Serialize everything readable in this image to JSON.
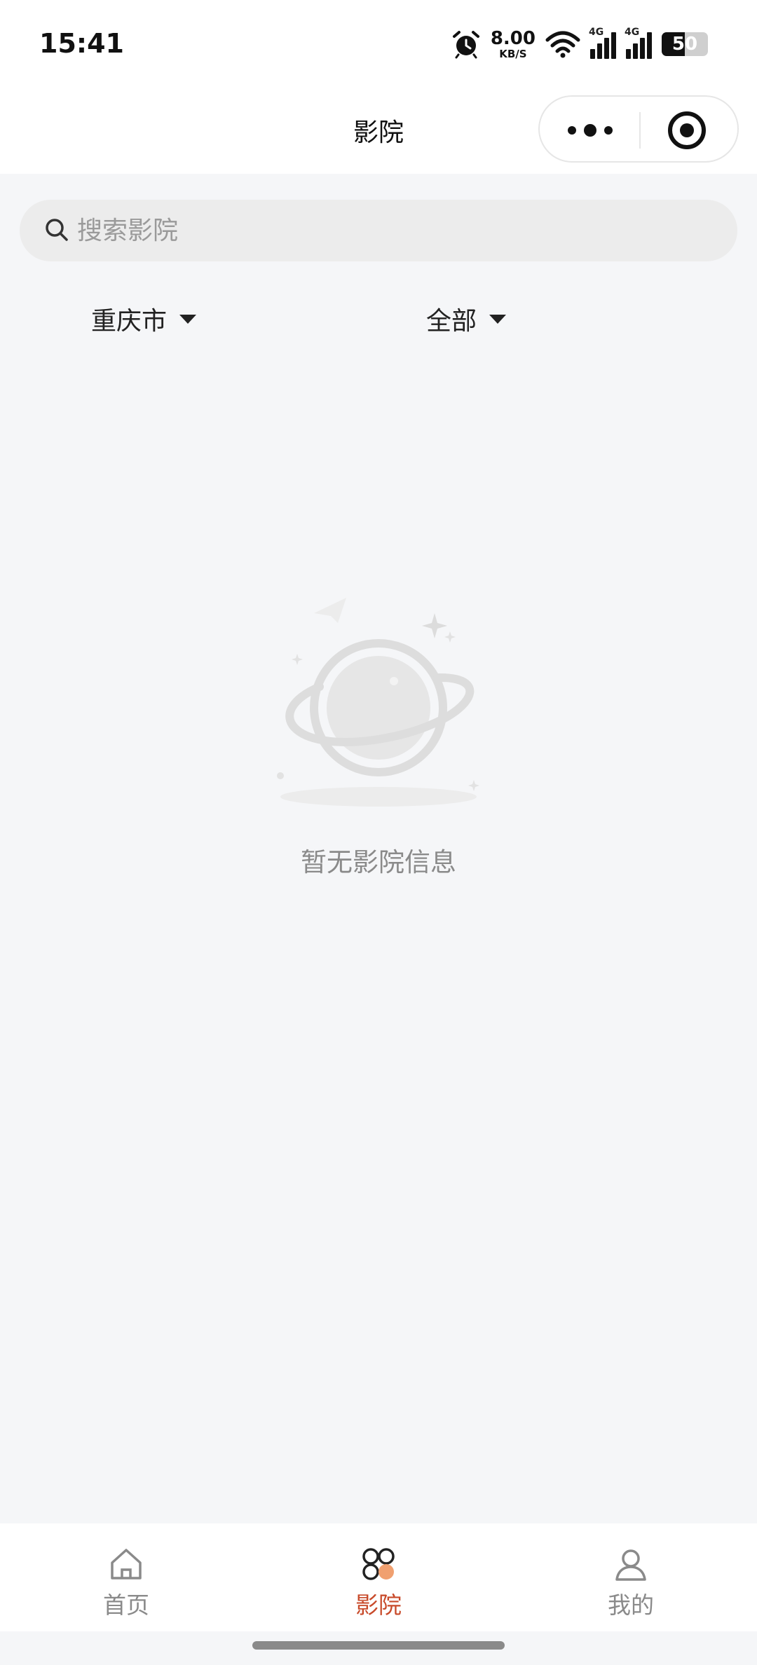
{
  "status_bar": {
    "time": "15:41",
    "net_speed_value": "8.00",
    "net_speed_unit": "KB/S",
    "sim1_label": "4G",
    "sim2_label": "4G",
    "battery_level": "50",
    "icons": [
      "alarm-icon",
      "wifi-icon",
      "signal-icon",
      "signal-icon",
      "battery-icon"
    ]
  },
  "nav": {
    "title": "影院",
    "capsule_icons": [
      "more-dots-icon",
      "close-target-icon"
    ]
  },
  "search": {
    "placeholder": "搜索影院",
    "value": ""
  },
  "filters": {
    "city": "重庆市",
    "category": "全部"
  },
  "empty_state": {
    "message": "暂无影院信息",
    "illustration": "planet-icon"
  },
  "tabbar": {
    "tabs": [
      {
        "label": "首页",
        "icon": "home-icon",
        "active": false
      },
      {
        "label": "影院",
        "icon": "clover-icon",
        "active": true
      },
      {
        "label": "我的",
        "icon": "person-icon",
        "active": false
      }
    ]
  },
  "colors": {
    "accent": "#c84a2a",
    "accent_light": "#f0a070",
    "background": "#f5f6f8",
    "tab_inactive": "#8a8a8a"
  }
}
